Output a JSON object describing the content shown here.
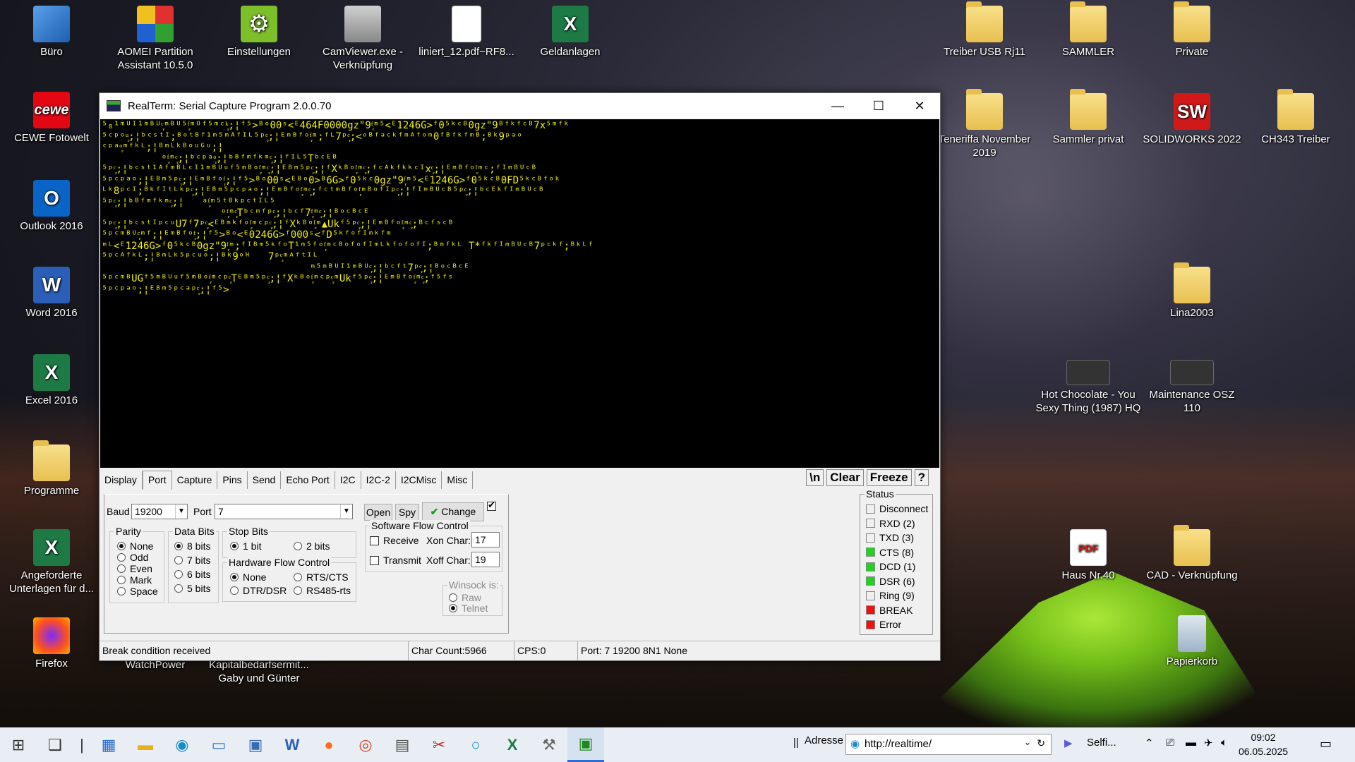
{
  "desktop": {
    "icons_left": [
      {
        "label": "Büro",
        "icon": "computer-icon"
      },
      {
        "label": "CEWE Fotowelt",
        "icon": "cewe-icon"
      },
      {
        "label": "Outlook 2016",
        "icon": "outlook-icon"
      },
      {
        "label": "Word 2016",
        "icon": "word-icon"
      },
      {
        "label": "Excel 2016",
        "icon": "excel-icon"
      },
      {
        "label": "Programme",
        "icon": "folder-icon"
      },
      {
        "label": "Angeforderte Unterlagen für d...",
        "icon": "excel-icon"
      },
      {
        "label": "Firefox",
        "icon": "firefox-icon"
      }
    ],
    "icons_top": [
      {
        "label": "AOMEI Partition Assistant 10.5.0",
        "icon": "aomei-icon"
      },
      {
        "label": "Einstellungen",
        "icon": "settings-gear-icon"
      },
      {
        "label": "CamViewer.exe - Verknüpfung",
        "icon": "camera-icon"
      },
      {
        "label": "liniert_12.pdf~RF8...",
        "icon": "document-icon"
      },
      {
        "label": "Geldanlagen",
        "icon": "excel-icon"
      }
    ],
    "icons_hidden": [
      {
        "label": "WatchPower"
      },
      {
        "label": "Kapitalbedarfsermit... Gaby und Günter"
      }
    ],
    "icons_right": [
      {
        "label": "Treiber USB Rj11",
        "icon": "folder-icon"
      },
      {
        "label": "SAMMLER",
        "icon": "folder-icon"
      },
      {
        "label": "Private",
        "icon": "folder-icon"
      },
      {
        "label": "Teneriffa November 2019",
        "icon": "folder-icon"
      },
      {
        "label": "Sammler privat",
        "icon": "folder-icon"
      },
      {
        "label": "SOLIDWORKS 2022",
        "icon": "solidworks-icon"
      },
      {
        "label": "CH343 Treiber",
        "icon": "folder-icon"
      },
      {
        "label": "Lina2003",
        "icon": "folder-icon"
      },
      {
        "label": "Hot Chocolate - You Sexy Thing (1987) HQ",
        "icon": "video-thumbnail-icon"
      },
      {
        "label": "Maintenance OSZ 110",
        "icon": "image-thumbnail-icon"
      },
      {
        "label": "Haus Nr.40",
        "icon": "pdf-icon"
      },
      {
        "label": "CAD - Verknüpfung",
        "icon": "folder-icon"
      },
      {
        "label": "Papierkorb",
        "icon": "recycle-bin-icon"
      }
    ]
  },
  "window": {
    "title": "RealTerm: Serial Capture Program 2.0.0.70",
    "controls": {
      "minimize": "—",
      "maximize": "☐",
      "close": "✕"
    },
    "terminal_lines": [
      "⁵₈¹ᵐᵁᴵ¹ᵐᴮᵁᶜ᷊ᵐᴮᵁ⁵ᶠ᷊ᵐᴼᶠ⁵ᵐᶜᵏ᷊;¦ᶠ⁵>ᴮᵒ00ˢ<ᴱ464F0000gz\"9ᶠ᷊ᵐ⁵<ᴱ1246G>ᶠ0⁵ᵏᶜᴮ0gz\"9ᴮᶠᵏᶠᶜᴮ7x⁵ᵐᶠᵏ",
      "⁵ᶜᵖᵒᵘ᷊;¦ᵇᶜˢᵗᴵ;ᴮᵒᵗᴮᶠ¹ᵐ⁵ᵐᴬᶠᴵᴸ⁵ᵖᶜ᷊;¦ᴱᵐᴮᶠᵒᶠ᷊ᵐ;ᶠᴸ7ᵖᶜ᷊;<ᵒᴮᶠᵃᶜᵏᶠᵐᴬᶠᵒᵐ0ᶠᴮᶠᵏᶠᵐᴮ;ᴮᵏ9ᵖᵃᵒ",
      "ᶜᵖᵃᵒ᷊ᵐᶠᵏᴸ;¦ᴮᵐᴸᵏᴮᵒᵘᴳᵘ;¦",
      "          ᵒᶠ᷊ᵐᶜ᷊;¦ᵇᶜᵖᵃᵒ᷊;¦ᵇᴮᶠᵐᶠᵏᵐᶜ᷊;¦ᶠᴵᴸ⁵Tᵇᶜᴱᴮ",
      "⁵ᵖᶜ᷊;¦ᵇᶜˢᵗ¹ᴬᶠᵐᴮᴸᶜᴵ¹ᵐᴮᵁᵘᶠ⁵ᵐᴮᵒᶠ᷊ᵐᶜ᷊;¦ᴱᴮᵐ⁵ᵖᶜ᷊;¦ᶠXᵏᴮᵒᶠ᷊ᵐᶜ᷊;ᶠᶜᴬᵏᶠᵏᵏᶜᴵxᶜ᷊;¦ᴱᵐᴮᶠᵒᶠ᷊ᵐᶜ;ᶠᴵᵐᴮᵁᶜᴮ",
      "⁵ᵖᶜᵖᵃᵒ;¦ᴱᴮᵐ⁵ᵖᶜ᷊;¦ᴱᵐᴮᶠᵒᶠ᷊;¦ᶠ⁵>ᴮᵒ00ˢ<ᴱᴮᵒ0>ᴮ6G>ᶠ0⁵ᵏᶜ0gz\"9ᶠ᷊ᵐ⁵<ᴱ1246G>ᶠ0⁵ᵏᶜᴮ0FD⁵ᵏᶜᴮᶠᵒᵏ",
      "ᴸᵏ8ᵖᶜᴵ;ᴮᵏᶠᴵᵗᴸᵏᵖᶜ᷊;¦ᴱᴮᵐ⁵ᵖᶜᵖᵃᵒ;¦ᴱᵐᴮᶠᵒᶠ᷊ᵐᶜ᷊;ᶠᶜᵗᵐᴮᶠᵒᶠ᷊ᵐᴮᵒᶠᴵᵖᶜ᷊;¦ᶠᴵᵐᴮᵁᶜᴮ⁵ᵖᶜ᷊;¦ᵇᶜᴱᵏᶠᴵᵐᴮᵁᶜᴮ",
      "⁵ᵖᶜ᷊;¦ᵇᴮᶠᵐᶠᵏᵐᶜ᷊;¦   ᵃᶠ᷊ᵐ⁵ᵗᴮᵏᵖᶜᵗᴵᴸ⁵",
      "                    ᵒᶠ᷊ᵐᶜ᷊Tᵇᶜᵐᶠᵖᶜ᷊;¦ᵇᶜᶠ7ᶠ᷊ᵐᶜ᷊;¦ᴮᵒᶜᴮᶜᴱ",
      "⁵ᵖᶜ᷊;¦ᵇᶜˢᵗᴵᵖᶜᵘU7ᶠ7ᵖᶜ᷊<ᴱᴮᵐᵏᶠᵒᶠ᷊ᵐᶜᵖᶜ᷊;¦ᶠXᵏᴮᵒᶠ᷊ᵐ▲Ukᶠ⁵ᵖᶜ᷊;¦ᴱᵐᴮᶠᵒᶠ᷊ᵐᶜ᷊;ᴮᶜᶠˢᶜᴮ",
      "⁵ᵖᶜᵐᴮᵁᶜ᷊ᵐᶠ;¦ᴱᵐᴮᶠᵒᶠ᷊;¦ᶠ⁵>ᴮᵒ<ᴱ0246G>ᶠ000ˢ<ᶠD⁵ᵏᶠᵒᶠᴵᵐᵏᶠᵐ",
      "ᵐᴸ<ᴱ1246G>ᶠ0⁵ᵏᶜᴮ0gz\"9ᶠ᷊ᵐ;ᶠᴵᴮᵐ⁵ᵏᶠᵒT¹ᵐ⁵ᶠᵒᶠ᷊ᵐᶜᴮᵒᶠᵒᶠᴵᵐᴸᵏᶠᵒᶠᵒᶠᴵ;ᴮᵐᶠᵏᴸ T*ᶠᵏᶠᴵᵐᴮᵁᶜᴮ7ᵖᶜᵏᶠ;ᴮᵏᴸᶠ",
      "⁵ᵖᶜᴬᶠᵏᴸ;¦ᴮᵐᴸᵏ⁵ᵖᶜᵘᵒ;¦ᴮᵏ9ᵒᴴ   7ᵖᶜ᷊ᵐᴬᶠᵗᴵᴸ",
      "                                   ᵐ⁵ᵐᴮᵁᴵ¹ᵐᴮᵁᶜ᷊;¦ᵇᶜᶠᵗ7ᵖᶜ᷊;¦ᴮᵒᶜᴮᶜᴱ",
      "⁵ᵖᶜᵐᴮUGᶠ⁵ᵐᴮᵁᵘᶠ⁵ᵐᴮᵒᶠ᷊ᵐᶜᵖᶜ᷊Tᴱᴮᵐ⁵ᵖᶜ᷊;¦ᶠXᵏᴮᵒᶠ᷊ᵐᶜᵖᶜ᷊ᵐUkᶠ⁵ᵖᶜ᷊;¦ᴱᵐᴮᶠᵒᶠ᷊ᵐᶜ᷊;ᶠ⁵ᶠˢ",
      "⁵ᵖᶜᵖᵃᵒ;¦ᴱᴮᵐ⁵ᵖᶜᵃᵖᶜ᷊;¦ᶠ⁵>"
    ],
    "tabs": [
      "Display",
      "Port",
      "Capture",
      "Pins",
      "Send",
      "Echo Port",
      "I2C",
      "I2C-2",
      "I2CMisc",
      "Misc"
    ],
    "active_tab": "Port",
    "tools": {
      "newline": "\\n",
      "clear": "Clear",
      "freeze": "Freeze",
      "help": "?"
    },
    "port": {
      "baud_label": "Baud",
      "baud_value": "19200",
      "port_label": "Port",
      "port_value": "7",
      "open": "Open",
      "spy": "Spy",
      "change": "Change",
      "parity": {
        "label": "Parity",
        "options": [
          "None",
          "Odd",
          "Even",
          "Mark",
          "Space"
        ],
        "selected": "None"
      },
      "data_bits": {
        "label": "Data Bits",
        "options": [
          "8 bits",
          "7 bits",
          "6 bits",
          "5 bits"
        ],
        "selected": "8 bits"
      },
      "stop_bits": {
        "label": "Stop Bits",
        "options": [
          "1 bit",
          "2 bits"
        ],
        "selected": "1 bit"
      },
      "hw_flow": {
        "label": "Hardware Flow Control",
        "options": [
          "None",
          "RTS/CTS",
          "DTR/DSR",
          "RS485-rts"
        ],
        "selected": "None"
      },
      "sw_flow": {
        "label": "Software Flow Control",
        "receive": "Receive",
        "transmit": "Transmit",
        "xon_label": "Xon Char:",
        "xon_value": "17",
        "xoff_label": "Xoff Char:",
        "xoff_value": "19"
      },
      "winsock": {
        "label": "Winsock is:",
        "options": [
          "Raw",
          "Telnet"
        ],
        "selected": "Telnet"
      }
    },
    "status_panel": {
      "label": "Status",
      "items": [
        {
          "label": "Disconnect",
          "color": "#f0f0f0"
        },
        {
          "label": "RXD (2)",
          "color": "#f0f0f0"
        },
        {
          "label": "TXD (3)",
          "color": "#f0f0f0"
        },
        {
          "label": "CTS (8)",
          "color": "#1ed41e"
        },
        {
          "label": "DCD (1)",
          "color": "#1ed41e"
        },
        {
          "label": "DSR (6)",
          "color": "#1ed41e"
        },
        {
          "label": "Ring (9)",
          "color": "#f0f0f0"
        },
        {
          "label": "BREAK",
          "color": "#f01010"
        },
        {
          "label": "Error",
          "color": "#f01010"
        }
      ]
    },
    "statusbar": {
      "message": "Break condition received",
      "char_count": "Char Count:5966",
      "cps": "CPS:0",
      "port_info": "Port: 7 19200 8N1 None"
    }
  },
  "taskbar": {
    "address_label": "Adresse",
    "address_value": "http://realtime/",
    "selfi": "Selfi...",
    "time": "09:02",
    "date": "06.05.2025"
  }
}
